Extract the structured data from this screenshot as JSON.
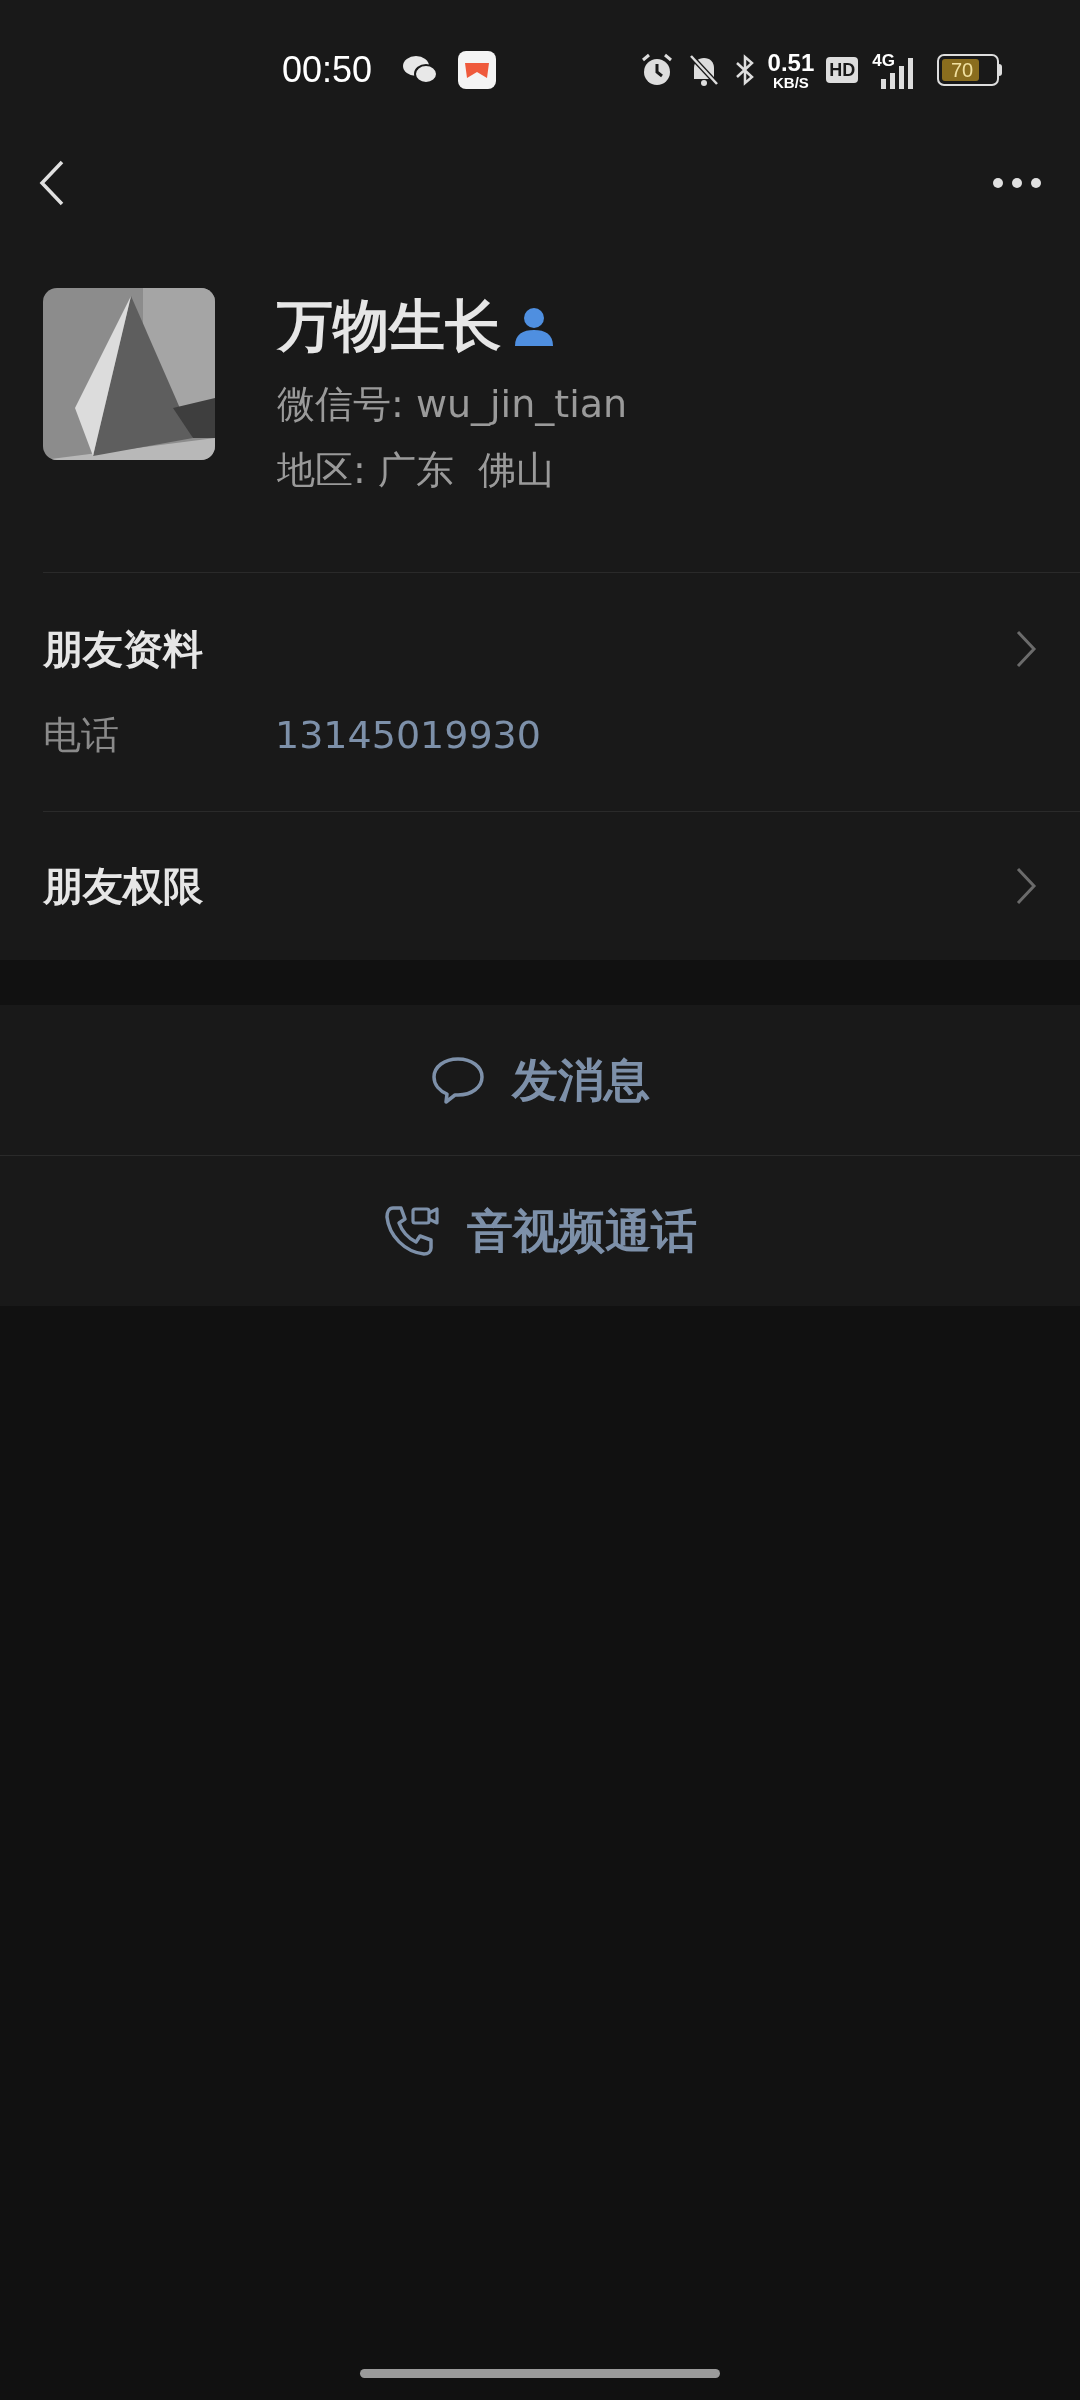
{
  "status_bar": {
    "time": "00:50",
    "net_speed": "0.51",
    "net_unit": "KB/S",
    "hd": "HD",
    "network": "4G",
    "battery": "70"
  },
  "profile": {
    "name": "万物生长",
    "wechat_id": "微信号: wu_jin_tian",
    "region": "地区: 广东  佛山"
  },
  "friend_info": {
    "title": "朋友资料",
    "rows": [
      {
        "label": "电话",
        "value": "13145019930"
      }
    ]
  },
  "friend_permissions": {
    "title": "朋友权限"
  },
  "actions": [
    {
      "kind": "message",
      "label": "发消息"
    },
    {
      "kind": "call",
      "label": "音视频通话"
    }
  ]
}
